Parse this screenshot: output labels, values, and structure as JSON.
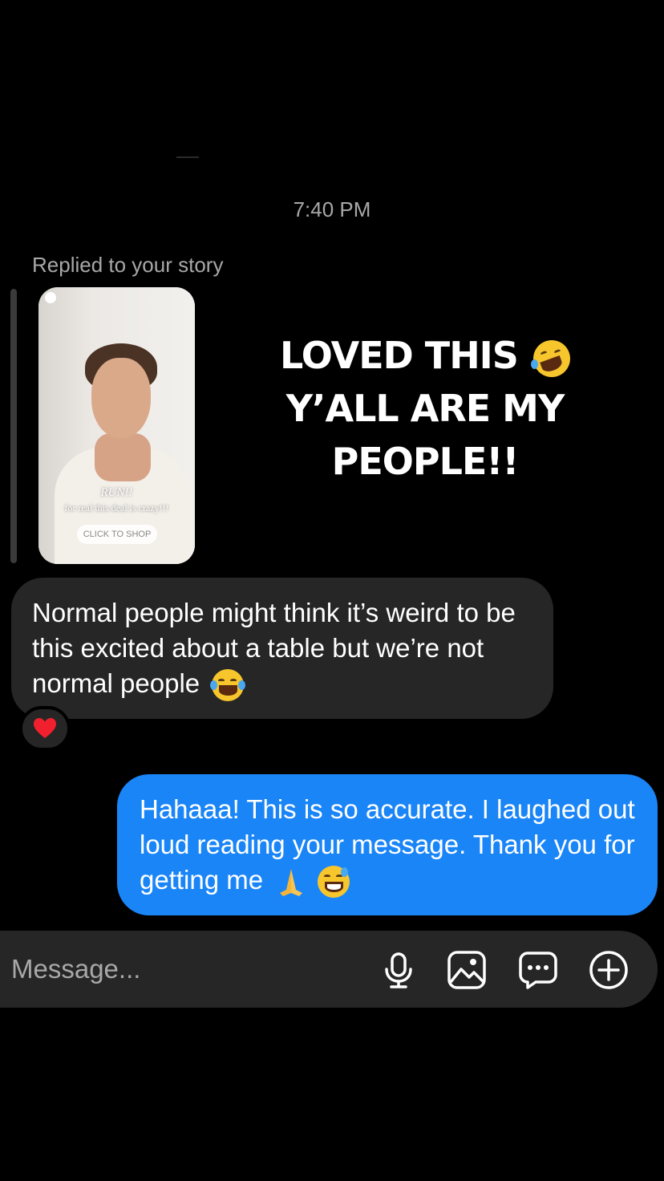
{
  "timestamp": "7:40 PM",
  "story_reply": {
    "label": "Replied to your story",
    "thumbnail": {
      "headline": "RUN!!",
      "subline": "for real this deal is crazy!!!",
      "cta": "CLICK TO SHOP"
    },
    "overlay_text_line1": "LOVED THIS",
    "overlay_text_line2": "Y’ALL ARE MY PEOPLE!!",
    "overlay_emoji": "rolling-on-floor-laughing"
  },
  "messages": [
    {
      "direction": "incoming",
      "text": "Normal people might think it’s weird to be this excited about a table but we’re not normal people",
      "emoji": "face-with-tears-of-joy",
      "reaction": "red-heart"
    },
    {
      "direction": "outgoing",
      "text": "Hahaaa! This is so accurate. I laughed out loud reading your message. Thank you for getting me",
      "emojis": [
        "folded-hands",
        "grinning-face-with-sweat"
      ]
    }
  ],
  "composer": {
    "placeholder": "Message...",
    "icons": [
      "microphone-icon",
      "gallery-icon",
      "sticker-chat-icon",
      "plus-icon"
    ]
  },
  "colors": {
    "background": "#000000",
    "incoming_bubble": "#262626",
    "outgoing_bubble": "#1a85f7",
    "secondary_text": "#a8a8a8"
  }
}
